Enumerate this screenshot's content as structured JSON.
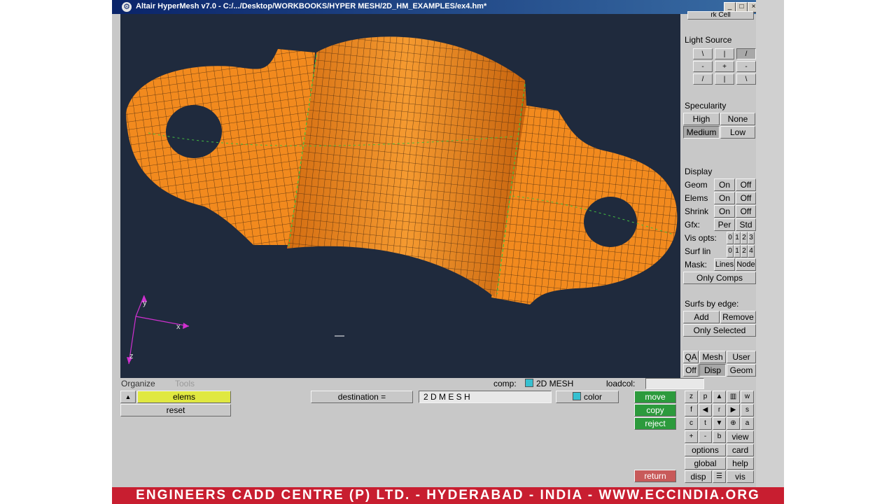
{
  "window": {
    "title": "Altair HyperMesh v7.0 - C:/.../Desktop/WORKBOOKS/HYPER MESH/2D_HM_EXAMPLES/ex4.hm*",
    "min_glyph": "_",
    "max_glyph": "□",
    "close_glyph": "×",
    "app_glyph": "⚙"
  },
  "panel": {
    "top_partial": "rk Cell",
    "light_source_label": "Light Source",
    "light_grid": [
      "\\",
      "|",
      "/",
      "-",
      "+",
      "-",
      "/",
      "|",
      "\\"
    ],
    "specularity_label": "Specularity",
    "spec_high": "High",
    "spec_none": "None",
    "spec_medium": "Medium",
    "spec_low": "Low",
    "display_label": "Display",
    "geom_label": "Geom",
    "elems_label": "Elems",
    "shrink_label": "Shrink",
    "gfx_label": "Gfx:",
    "on": "On",
    "off": "Off",
    "per": "Per",
    "std": "Std",
    "vis_opts_label": "Vis opts:",
    "surf_lin_label": "Surf lin",
    "digits": [
      "0",
      "1",
      "2",
      "3"
    ],
    "digits2": [
      "0",
      "1",
      "2",
      "4"
    ],
    "mask_label": "Mask:",
    "mask_lines": "Lines",
    "mask_node": "Node",
    "only_comps": "Only Comps",
    "surfs_by_edge": "Surfs by edge:",
    "add": "Add",
    "remove": "Remove",
    "only_selected": "Only Selected",
    "qa": "QA",
    "mesh": "Mesh",
    "user": "User",
    "off_tab": "Off",
    "disp_tab": "Disp",
    "geom_tab": "Geom"
  },
  "status": {
    "organize": "Organize",
    "tools": "Tools",
    "comp_label": "comp:",
    "comp_value": "2D MESH",
    "loadcol_label": "loadcol:"
  },
  "menu": {
    "up_arrow": "▲",
    "elems": "elems",
    "reset": "reset",
    "destination_label": "destination =",
    "destination_value": "2 D   M E S H",
    "color": "color",
    "move": "move",
    "copy": "copy",
    "reject": "reject",
    "return": "return"
  },
  "viewctl": {
    "r1": [
      "z",
      "p",
      "▲",
      "▥",
      "w"
    ],
    "r2": [
      "f",
      "◀",
      "r",
      "▶",
      "s"
    ],
    "r3": [
      "c",
      "t",
      "▼",
      "⊕",
      "a"
    ],
    "r4": [
      "+",
      "-",
      "b"
    ],
    "view": "view",
    "options": "options",
    "card": "card",
    "global": "global",
    "help": "help",
    "disp": "disp",
    "vis": "vis",
    "tree_glyph": "☰"
  },
  "axes": {
    "x": "x",
    "y": "y",
    "z": "z"
  },
  "footer": "ENGINEERS CADD CENTRE (P) LTD. - HYDERABAD - INDIA - WWW.ECCINDIA.ORG",
  "colors": {
    "mesh": "#f28a1e",
    "mesh_lines": "#4a2a10",
    "background": "#1f2a3d",
    "accent_green": "#2c9a3c",
    "accent_red": "#c85a5a"
  }
}
